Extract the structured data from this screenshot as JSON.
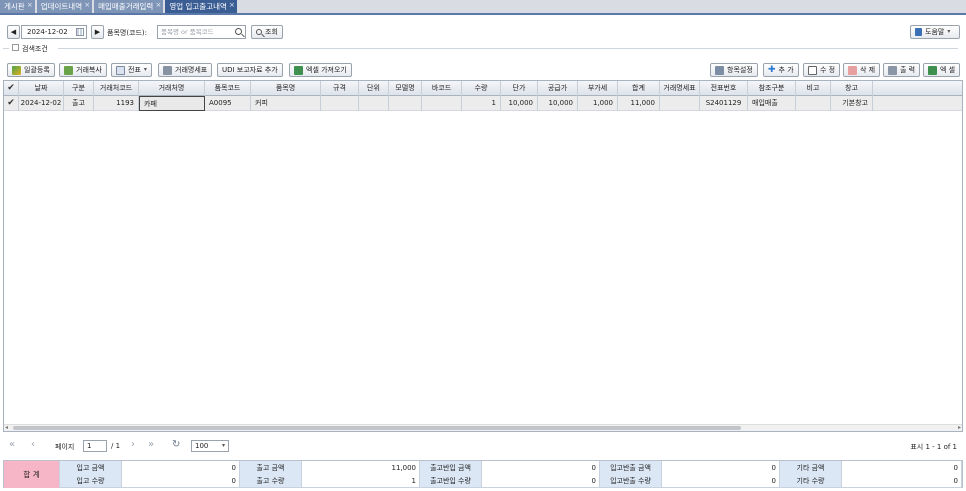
{
  "tabs": [
    {
      "label": "게시판",
      "active": false
    },
    {
      "label": "업데이트내역",
      "active": false
    },
    {
      "label": "매입매출거래입력",
      "active": false
    },
    {
      "label": "영업 입고출고내역",
      "active": true
    }
  ],
  "filters": {
    "date": "2024-12-02",
    "item_label": "품목명(코드):",
    "item_placeholder": "품목명 or 품목코드",
    "search_button": "조회",
    "help_button": "도움말",
    "search_condition": "검색조건"
  },
  "actions_left": {
    "register": "일괄등록",
    "copy": "거래복사",
    "slip": "전표",
    "statement": "거래명세표",
    "udi": "UDI 보고자료 추가",
    "excel_import": "엑셀 가져오기"
  },
  "actions_right": {
    "columns": "항목설정",
    "add": "추 가",
    "edit": "수 정",
    "delete": "삭 제",
    "print": "출 력",
    "excel": "엑 셀"
  },
  "grid": {
    "columns": [
      "날짜",
      "구분",
      "거래처코드",
      "거래처명",
      "품목코드",
      "품목명",
      "규격",
      "단위",
      "모델명",
      "바코드",
      "수량",
      "단가",
      "공급가",
      "부가세",
      "합계",
      "거래명세표",
      "전표번호",
      "참조구분",
      "비고",
      "창고"
    ],
    "rows": [
      [
        "2024-12-02",
        "출고",
        "1193",
        "카페",
        "A0095",
        "커피",
        "",
        "",
        "",
        "",
        "1",
        "10,000",
        "10,000",
        "1,000",
        "11,000",
        "",
        "S2401129",
        "매입매출",
        "",
        "기본창고"
      ]
    ]
  },
  "pager": {
    "page_label": "페이지",
    "page": "1",
    "total_pages": "/ 1",
    "page_size": "100",
    "display": "표시 1 - 1 of 1"
  },
  "summary": {
    "total_label": "합 계",
    "cells": [
      {
        "label": "입고 금액",
        "value": "0"
      },
      {
        "label": "입고 수량",
        "value": "0"
      },
      {
        "label": "출고 금액",
        "value": "11,000"
      },
      {
        "label": "출고 수량",
        "value": "1"
      },
      {
        "label": "출고반입 금액",
        "value": "0"
      },
      {
        "label": "출고반입 수량",
        "value": "0"
      },
      {
        "label": "입고반출 금액",
        "value": "0"
      },
      {
        "label": "입고반출 수량",
        "value": "0"
      },
      {
        "label": "기타 금액",
        "value": "0"
      },
      {
        "label": "기타 수량",
        "value": "0"
      }
    ]
  },
  "colors": {
    "tab_active": "#3a5d94",
    "tab_inactive": "#7e95b8",
    "summary_label": "#dbe7f5",
    "total_cell": "#f7b6c8"
  }
}
